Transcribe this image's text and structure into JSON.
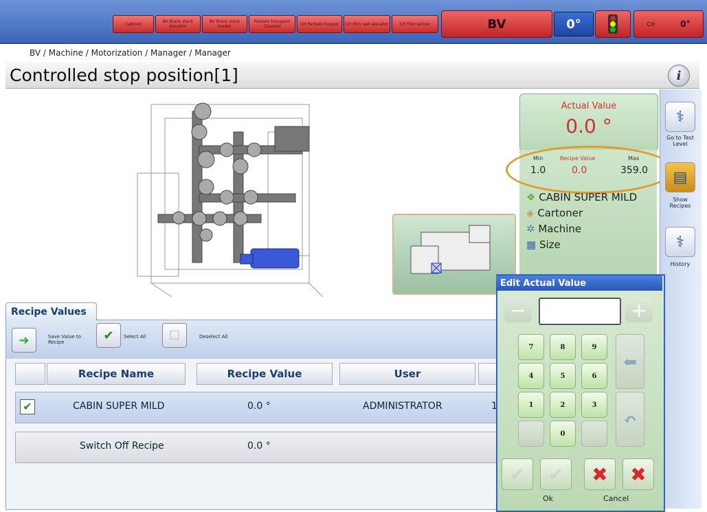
{
  "topbar": {
    "buttons": [
      "Cabinet",
      "BV Blank stack elevator",
      "BV Blank stack loader",
      "Packets transport Channel",
      "CH Packets hopper",
      "CH Film reel elevator",
      "CH Film splicer"
    ],
    "machine": "BV",
    "counter": "0°",
    "right_label": "CH",
    "right_value": "0°"
  },
  "breadcrumb": "BV / Machine / Motorization / Manager / Manager",
  "page_title": "Controlled stop position[1]",
  "info_label": "i",
  "actual": {
    "title": "Actual Value",
    "value": "0.0 °",
    "min_label": "Min",
    "min": "1.0",
    "recipe_label": "Recipe Value",
    "recipe": "0.0",
    "max_label": "Max",
    "max": "359.0"
  },
  "context_items": [
    "CABIN SUPER MILD",
    "Cartoner",
    "Machine",
    "Size"
  ],
  "side_buttons": [
    {
      "label": "Go to Test Level",
      "icon": "stethoscope-icon"
    },
    {
      "label": "Show Recipes",
      "icon": "recipe-book-icon"
    },
    {
      "label": "History",
      "icon": "history-stethoscope-icon"
    }
  ],
  "recipe_tab": "Recipe Values",
  "toolbar": {
    "save_label": "Save Value to Recipe",
    "select_all": "Select All",
    "deselect_all": "Deselect All"
  },
  "table": {
    "headers": [
      "Recipe Name",
      "Recipe Value",
      "User"
    ],
    "rows": [
      {
        "name": "CABIN SUPER MILD",
        "value": "0.0 °",
        "user": "ADMINISTRATOR",
        "extra": "1",
        "checked": true
      },
      {
        "name": "Switch Off Recipe",
        "value": "0.0 °",
        "user": "",
        "extra": "",
        "checked": false
      }
    ]
  },
  "keypad": {
    "title": "Edit Actual Value",
    "input_value": "",
    "keys": [
      "7",
      "8",
      "9",
      "4",
      "5",
      "6",
      "1",
      "2",
      "3",
      "0"
    ],
    "ok_label": "Ok",
    "cancel_label": "Cancel"
  },
  "colors": {
    "accent": "#2e62c4",
    "alarm": "#c92b2b",
    "highlight": "#e09a30"
  }
}
